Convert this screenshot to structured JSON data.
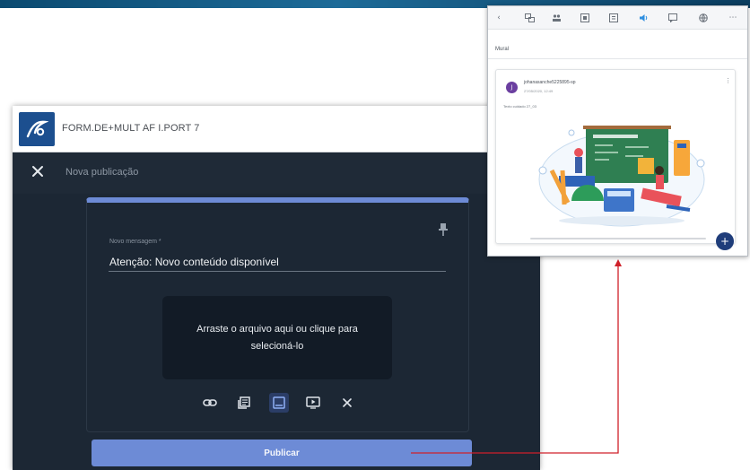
{
  "main_window": {
    "course_title": "FORM.DE+MULT AF I.PORT 7",
    "dialog_title": "Nova publicação",
    "message_label": "Novo mensagem *",
    "message_value": "Atenção: Novo conteúdo disponível",
    "dropzone_text": "Arraste o arquivo aqui ou clique para selecioná-lo",
    "attachment_icons": [
      "link-icon",
      "document-icon",
      "image-icon",
      "video-icon",
      "close-icon"
    ],
    "active_attachment": "image-icon",
    "publish_label": "Publicar",
    "colors": {
      "accent": "#6d8bd6",
      "panel": "#1c2734",
      "logo": "#1c4f8f"
    }
  },
  "mural_window": {
    "toolbar_icons": [
      "back-icon",
      "share-icon",
      "people-icon",
      "grid-icon",
      "copy-icon",
      "sound-icon",
      "chat-icon",
      "globe-icon",
      "more-icon"
    ],
    "title": "Mural",
    "post": {
      "author": "johanasanche5225895-sp",
      "date": "27/05/2020, 12:49",
      "text": "Texto cuidado 27_03"
    },
    "fab_label": "+",
    "colors": {
      "avatar": "#6b3fa0",
      "fab": "#1f3d7a"
    }
  },
  "annotation": {
    "arrow_color": "#d0202a"
  }
}
